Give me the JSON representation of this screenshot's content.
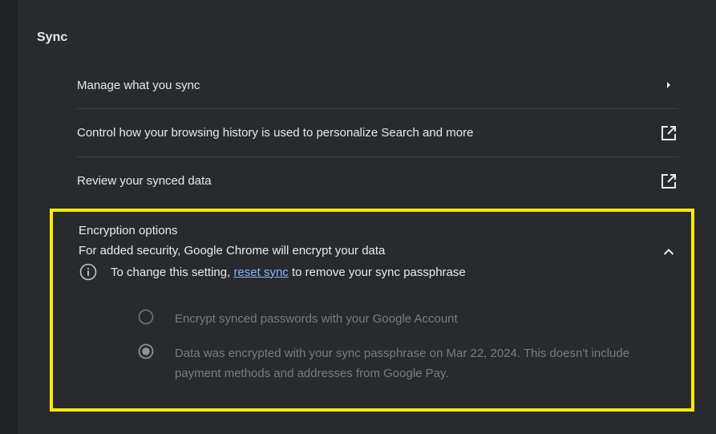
{
  "sync": {
    "title": "Sync",
    "rows": [
      {
        "label": "Manage what you sync",
        "icon": "chevron-right-icon"
      },
      {
        "label": "Control how your browsing history is used to personalize Search and more",
        "icon": "open-in-new-icon"
      },
      {
        "label": "Review your synced data",
        "icon": "open-in-new-icon"
      }
    ]
  },
  "encryption": {
    "title": "Encryption options",
    "subtitle": "For added security, Google Chrome will encrypt your data",
    "info_prefix": "To change this setting,",
    "info_link": "reset sync",
    "info_suffix": "to remove your sync passphrase",
    "options": [
      {
        "label": "Encrypt synced passwords with your Google Account",
        "selected": false
      },
      {
        "label": "Data was encrypted with your sync passphrase on Mar 22, 2024. This doesn't include payment methods and addresses from Google Pay.",
        "selected": true
      }
    ]
  },
  "colors": {
    "background": "#202124",
    "card": "#292a2d",
    "highlight_border": "#ffeb00",
    "link": "#8ab4f8",
    "disabled_text": "#7a7c80"
  }
}
